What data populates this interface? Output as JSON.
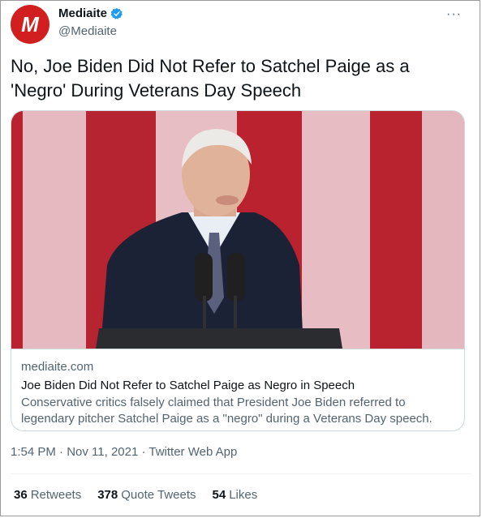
{
  "author": {
    "display_name": "Mediaite",
    "handle": "@Mediaite",
    "avatar_letter": "M",
    "avatar_color": "#d11f1f",
    "verified": true
  },
  "tweet": {
    "text": "No, Joe Biden Did Not Refer to Satchel Paige as a 'Negro' During Veterans Day Speech",
    "timestamp": "1:54 PM · Nov 11, 2021 · Twitter Web App"
  },
  "card": {
    "domain": "mediaite.com",
    "title": "Joe Biden Did Not Refer to Satchel Paige as Negro in Speech",
    "description": "Conservative critics falsely claimed that President Joe Biden referred to legendary pitcher Satchel Paige as a \"negro\" during a Veterans Day speech."
  },
  "stats": [
    {
      "count": "36",
      "label": "Retweets"
    },
    {
      "count": "378",
      "label": "Quote Tweets"
    },
    {
      "count": "54",
      "label": "Likes"
    }
  ],
  "icons": {
    "more": "more-icon",
    "verified": "verified-badge-icon"
  },
  "colors": {
    "accent": "#1d9bf0",
    "secondary_text": "#536471"
  }
}
